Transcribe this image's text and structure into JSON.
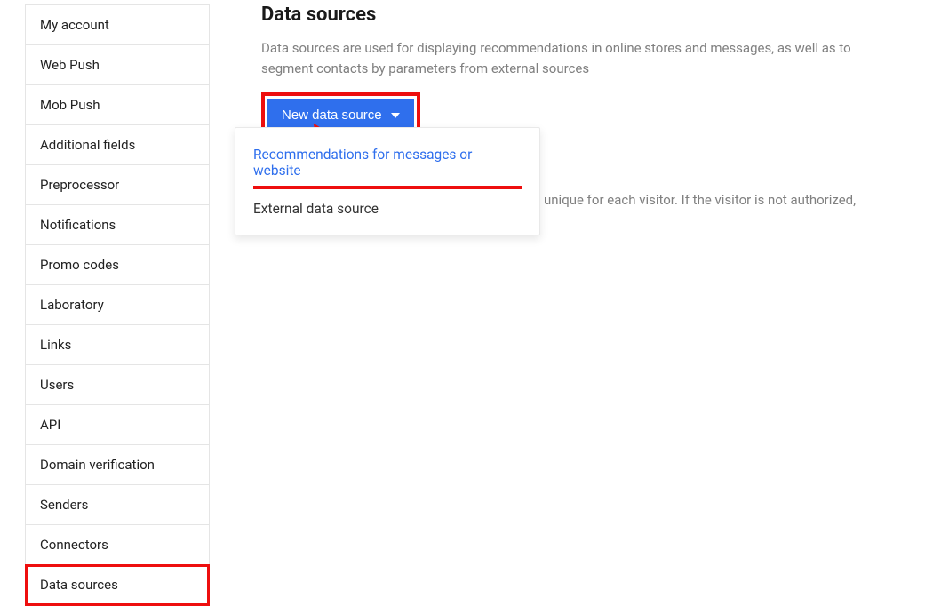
{
  "sidebar": {
    "items": [
      {
        "label": "My account"
      },
      {
        "label": "Web Push"
      },
      {
        "label": "Mob Push"
      },
      {
        "label": "Additional fields"
      },
      {
        "label": "Preprocessor"
      },
      {
        "label": "Notifications"
      },
      {
        "label": "Promo codes"
      },
      {
        "label": "Laboratory"
      },
      {
        "label": "Links"
      },
      {
        "label": "Users"
      },
      {
        "label": "API"
      },
      {
        "label": "Domain verification"
      },
      {
        "label": "Senders"
      },
      {
        "label": "Connectors"
      },
      {
        "label": "Data sources"
      }
    ],
    "active_index": 14
  },
  "main": {
    "title": "Data sources",
    "description": "Data sources are used for displaying recommendations in online stores and messages, as well as to segment contacts by parameters from external sources",
    "new_button_label": "New data source",
    "dropdown": {
      "items": [
        {
          "label": "Recommendations for messages or website",
          "highlight": true
        },
        {
          "label": "External data source",
          "highlight": false
        }
      ]
    },
    "background_body_fragment": "unique for each visitor. If the visitor is not authorized,"
  },
  "colors": {
    "accent": "#2f6fed",
    "annotation": "#ee0e0e",
    "muted": "#808080"
  }
}
